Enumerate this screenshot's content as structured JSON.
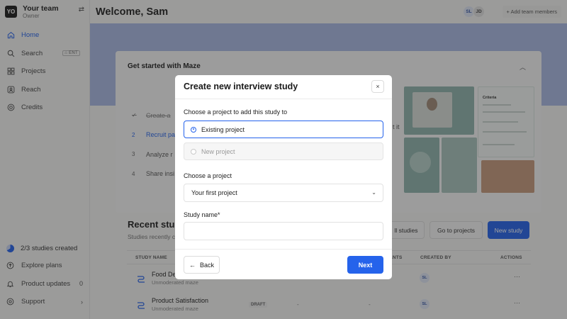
{
  "sidebar": {
    "team_initials": "YO",
    "team_name": "Your team",
    "team_role": "Owner",
    "items": [
      {
        "label": "Home",
        "icon": "home-icon",
        "active": true
      },
      {
        "label": "Search",
        "icon": "search-icon",
        "shortcut": "ENT"
      },
      {
        "label": "Projects",
        "icon": "grid-icon"
      },
      {
        "label": "Reach",
        "icon": "reach-icon"
      },
      {
        "label": "Credits",
        "icon": "credits-icon"
      }
    ],
    "studies_created": "2/3 studies created",
    "bottom_items": [
      {
        "label": "Explore plans",
        "icon": "arrow-circle-icon",
        "right": ""
      },
      {
        "label": "Product updates",
        "icon": "bell-icon",
        "right": "0"
      },
      {
        "label": "Support",
        "icon": "help-icon",
        "right": "›"
      }
    ]
  },
  "header": {
    "welcome": "Welcome, Sam",
    "avatars": [
      "SL",
      "JD"
    ],
    "add_members": "+ Add team members"
  },
  "get_started": {
    "title": "Get started with Maze",
    "steps": [
      {
        "num": "✓",
        "label": "Create a"
      },
      {
        "num": "2",
        "label": "Recruit pa"
      },
      {
        "num": "3",
        "label": "Analyze r"
      },
      {
        "num": "4",
        "label": "Share insi"
      }
    ],
    "tail_text": "t it",
    "illustration_title": "Criteria"
  },
  "recent": {
    "title": "Recent stud",
    "subtitle": "Studies recently c",
    "all_studies": "ll studies",
    "go_to_projects": "Go to projects",
    "new_study": "New study",
    "columns": [
      "STUDY NAME",
      "ANTS",
      "CREATED BY",
      "ACTIONS"
    ],
    "rows": [
      {
        "name": "Food De",
        "type": "Unmoderated maze",
        "status": "",
        "c1": "",
        "c2": "",
        "creator": "SL"
      },
      {
        "name": "Product Satisfaction",
        "type": "Unmoderated maze",
        "status": "DRAFT",
        "c1": "-",
        "c2": "-",
        "creator": "SL"
      }
    ]
  },
  "modal": {
    "title": "Create new interview study",
    "close_label": "×",
    "project_question": "Choose a project to add this study to",
    "options": [
      {
        "label": "Existing project",
        "selected": true
      },
      {
        "label": "New project",
        "selected": false
      }
    ],
    "choose_project_label": "Choose a project",
    "selected_project": "Your first project",
    "study_name_label": "Study name",
    "required_mark": "*",
    "study_name_value": "",
    "back_label": "Back",
    "next_label": "Next"
  },
  "colors": {
    "accent": "#2563eb",
    "banner": "#a9b9e4",
    "overlay": "rgba(30,30,30,0.42)"
  }
}
